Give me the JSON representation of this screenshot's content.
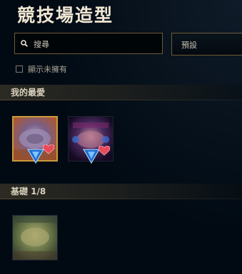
{
  "header": {
    "title": "競技場造型"
  },
  "search": {
    "placeholder": "搜尋"
  },
  "filter": {
    "selected": "預設"
  },
  "show_unowned": {
    "label": "顯示未擁有",
    "checked": false
  },
  "favorites": {
    "label": "我的最愛",
    "items": [
      {
        "name": "arena-skin-1",
        "selected": true,
        "favorited": true
      },
      {
        "name": "arena-skin-2",
        "selected": false,
        "favorited": true
      }
    ]
  },
  "basic": {
    "label": "基礎 1/8",
    "items": [
      {
        "name": "arena-skin-basic-1",
        "selected": false,
        "favorited": false
      }
    ]
  },
  "colors": {
    "gold_border": "#c89b3c",
    "heart": "#e84a5a",
    "badge": "#2a8fe0",
    "background": "#010a13"
  }
}
